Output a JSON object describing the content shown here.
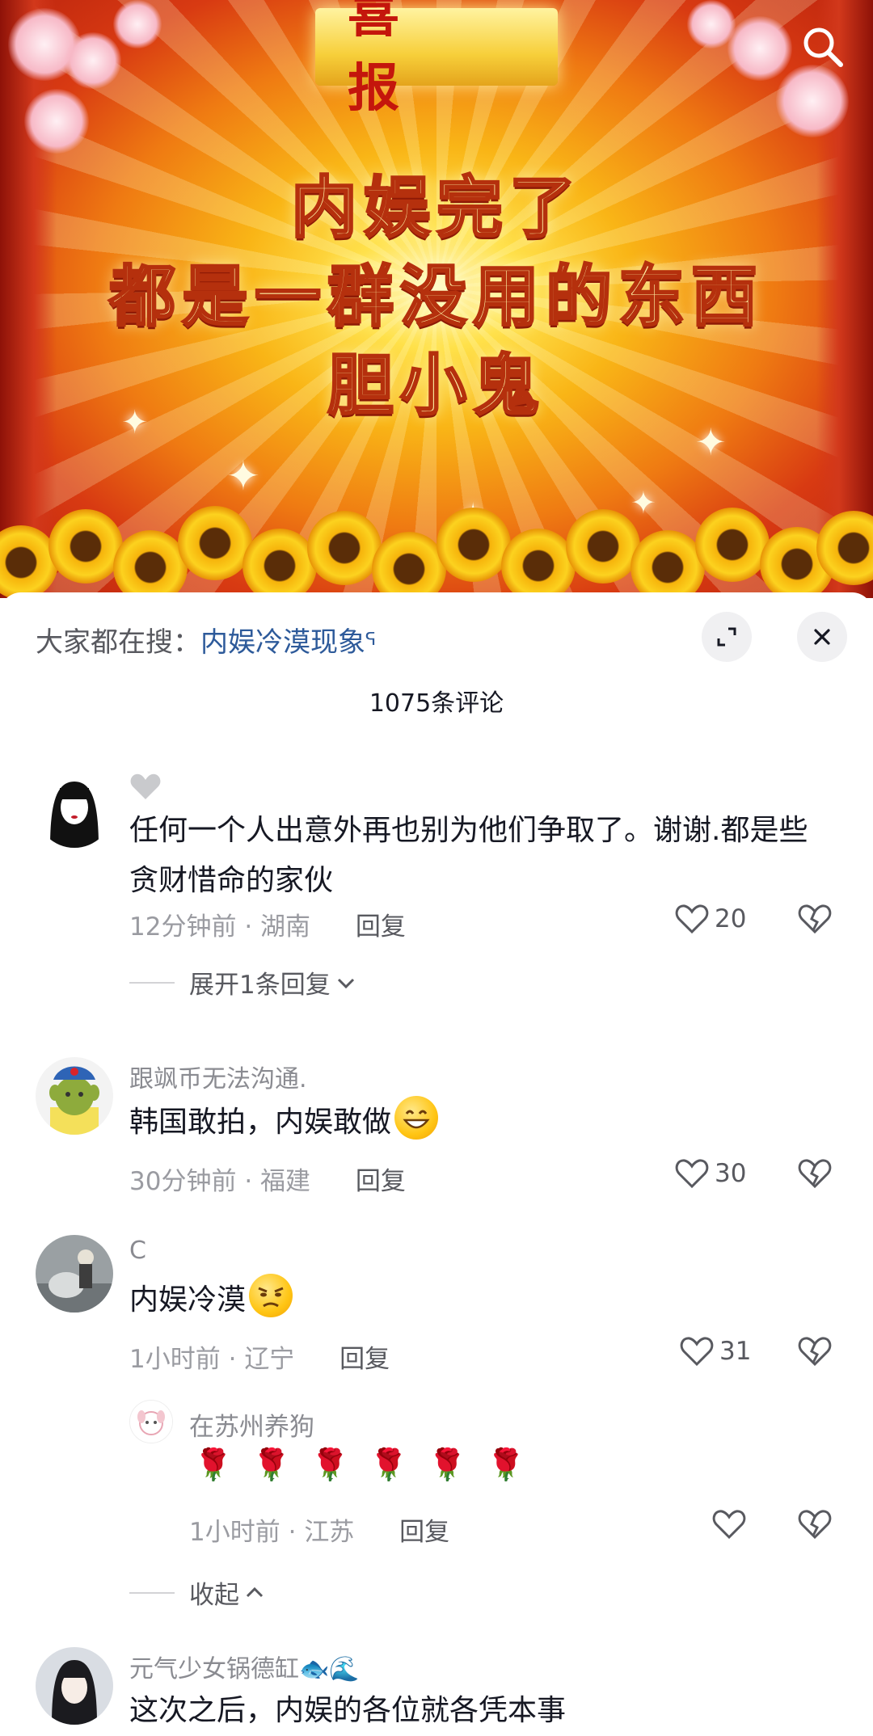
{
  "banner": {
    "plaque": "喜 报",
    "headline_lines": [
      "内娱完了",
      "都是一群没用的东西",
      "胆小鬼"
    ]
  },
  "sheet": {
    "hot_search_label": "大家都在搜：",
    "hot_search_keyword": "内娱冷漠现象",
    "comment_count": "1075条评论"
  },
  "comments": [
    {
      "name": "",
      "text": "任何一个人出意外再也别为他们争取了。谢谢.都是些贪财惜命的家伙",
      "time": "12分钟前",
      "location": "湖南",
      "reply_label": "回复",
      "likes": "20",
      "expand_label": "展开1条回复"
    },
    {
      "name": "跟飒币无法沟通.",
      "text": "韩国敢拍，内娱敢做",
      "emoji": "grinning-face-emoji",
      "time": "30分钟前",
      "location": "福建",
      "reply_label": "回复",
      "likes": "30"
    },
    {
      "name": "C",
      "text": "内娱冷漠",
      "emoji": "unamused-face-emoji",
      "time": "1小时前",
      "location": "辽宁",
      "reply_label": "回复",
      "likes": "31",
      "reply": {
        "name": "在苏州养狗",
        "roses": [
          "🌹",
          "🌹",
          "🌹",
          "🌹",
          "🌹",
          "🌹"
        ],
        "time": "1小时前",
        "location": "江苏",
        "reply_label": "回复"
      },
      "collapse_label": "收起"
    },
    {
      "name": "元气少女锅德缸",
      "name_emoji": "🐟🌊",
      "text": "这次之后，内娱的各位就各凭本事"
    }
  ],
  "separator": "·",
  "colors": {
    "keyword": "#2d5a9a",
    "secondary_text": "#9a9ba1",
    "primary_text": "#161823"
  }
}
